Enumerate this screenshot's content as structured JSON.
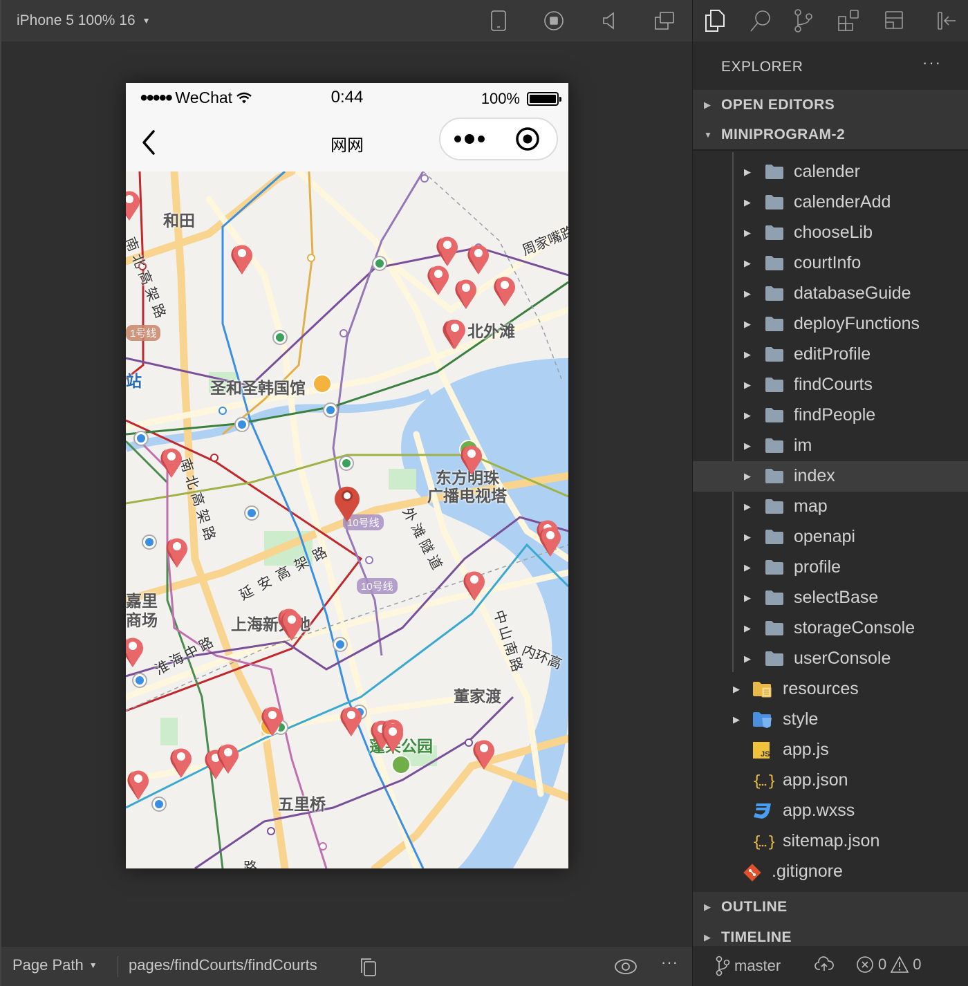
{
  "simulator": {
    "device_label": "iPhone 5 100% 16",
    "toolbar_icons": [
      "phone-icon",
      "record-icon",
      "volume-icon",
      "detach-window-icon"
    ],
    "phone": {
      "status": {
        "signal": "●●●●●",
        "carrier": "WeChat",
        "time": "0:44",
        "battery_percent": "100%",
        "battery_level": 1.0
      },
      "nav": {
        "title": "网网",
        "back_icon": "chevron-left-icon",
        "more_icon": "more-dots-icon",
        "close_icon": "target-close-icon"
      },
      "map": {
        "labels": [
          {
            "id": "hetian",
            "text": "和田"
          },
          {
            "id": "beiwaitan",
            "text": "北外滩"
          },
          {
            "id": "shenghe",
            "text": "圣和圣韩国馆"
          },
          {
            "id": "dongfang1",
            "text": "东方明珠"
          },
          {
            "id": "dongfang2",
            "text": "广播电视塔"
          },
          {
            "id": "xintiandi",
            "text": "上海新天地"
          },
          {
            "id": "dongjiadu",
            "text": "董家渡"
          },
          {
            "id": "penglai",
            "text": "蓬莱公园"
          },
          {
            "id": "wuliqiao",
            "text": "五里桥"
          },
          {
            "id": "zhan",
            "text": "站"
          },
          {
            "id": "jiali1",
            "text": "嘉里"
          },
          {
            "id": "jiali2",
            "text": "商场"
          }
        ],
        "road_labels": [
          {
            "id": "nanbei1",
            "text": "南北高架路"
          },
          {
            "id": "nanbei2",
            "text": "南北高架路"
          },
          {
            "id": "yanan",
            "text": "延安高架路"
          },
          {
            "id": "huaihai",
            "text": "淮海中路"
          },
          {
            "id": "waitan",
            "text": "外滩隧道"
          },
          {
            "id": "zhongshan",
            "text": "中山南路"
          },
          {
            "id": "zhoujiazui",
            "text": "周家嘴路"
          },
          {
            "id": "neihuan",
            "text": "内环高"
          },
          {
            "id": "bottom",
            "text": "路"
          }
        ],
        "line_badges": [
          {
            "id": "line1",
            "text": "1号线"
          },
          {
            "id": "line10a",
            "text": "10号线"
          },
          {
            "id": "line10b",
            "text": "10号线"
          }
        ],
        "marker_count": 31,
        "selected_marker_count": 1
      }
    },
    "bottom_bar": {
      "page_path_label": "Page Path",
      "page_path_value": "pages/findCourts/findCourts",
      "more": "···"
    }
  },
  "explorer": {
    "title": "EXPLORER",
    "more": "···",
    "activity_icons": [
      "files-icon",
      "search-icon",
      "source-control-icon",
      "extensions-icon",
      "layout-icon",
      "collapse-panel-icon"
    ],
    "sections": {
      "open_editors": "OPEN EDITORS",
      "project": "MINIPROGRAM-2",
      "outline": "OUTLINE",
      "timeline": "TIMELINE"
    },
    "page_folders": [
      "calender",
      "calenderAdd",
      "chooseLib",
      "courtInfo",
      "databaseGuide",
      "deployFunctions",
      "editProfile",
      "findCourts",
      "findPeople",
      "im",
      "index",
      "map",
      "openapi",
      "profile",
      "selectBase",
      "storageConsole",
      "userConsole"
    ],
    "selected_folder": "index",
    "root_items": [
      {
        "name": "resources",
        "type": "folder-resources"
      },
      {
        "name": "style",
        "type": "folder-style"
      },
      {
        "name": "app.js",
        "type": "js"
      },
      {
        "name": "app.json",
        "type": "json"
      },
      {
        "name": "app.wxss",
        "type": "css"
      },
      {
        "name": "sitemap.json",
        "type": "json"
      },
      {
        "name": ".gitignore",
        "type": "git"
      }
    ],
    "status": {
      "branch": "master",
      "errors": "0",
      "warnings": "0"
    }
  },
  "colors": {
    "marker": "#e8686a",
    "marker_selected": "#d24b3c",
    "water": "#aed0f2",
    "park": "#cdeccb"
  }
}
